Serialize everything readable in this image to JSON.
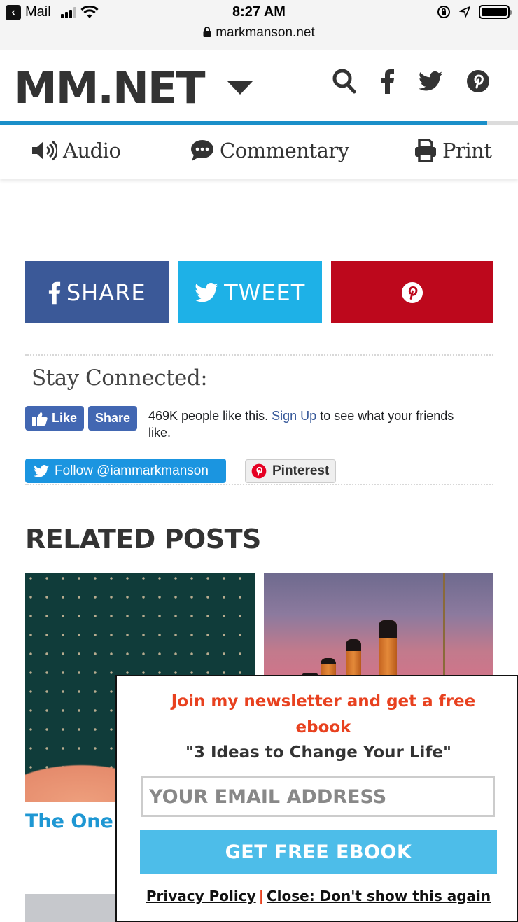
{
  "status_bar": {
    "back_app": "Mail",
    "time": "8:27 AM",
    "url": "markmanson.net",
    "icons": [
      "back-arrow-icon",
      "cellular-signal-icon",
      "wifi-icon",
      "orientation-lock-icon",
      "location-icon",
      "battery-icon"
    ]
  },
  "header": {
    "logo": "MM.NET",
    "menu_icon": "caret-down-icon",
    "icons": [
      "search-icon",
      "facebook-icon",
      "twitter-icon",
      "pinterest-icon"
    ],
    "read_progress_percent": 94,
    "colors": {
      "progress": "#1a8fc9",
      "text": "#333333"
    }
  },
  "tools": {
    "audio": "Audio",
    "commentary": "Commentary",
    "print": "Print"
  },
  "share": {
    "facebook_label": "SHARE",
    "twitter_label": "TWEET",
    "colors": {
      "facebook": "#3b5998",
      "twitter": "#1eb1e7",
      "pinterest": "#bd081c"
    }
  },
  "stay_connected": {
    "heading": "Stay Connected:",
    "fb_like": "Like",
    "fb_share": "Share",
    "fb_text_before": "469K people like this.",
    "fb_signup": "Sign Up",
    "fb_text_after": "to see what your friends like.",
    "twitter_follow": "Follow @iammarkmanson",
    "pinterest_follow": "Pinterest"
  },
  "related": {
    "heading": "RELATED POSTS",
    "posts": [
      {
        "title_visible": "The One "
      },
      {
        "title_visible": ""
      }
    ]
  },
  "popup": {
    "headline": "Join my newsletter and get a free ebook",
    "subtitle": "\"3 Ideas to Change Your Life\"",
    "email_placeholder": "YOUR EMAIL ADDRESS",
    "email_value": "",
    "button": "GET FREE EBOOK",
    "privacy": "Privacy Policy",
    "separator": "|",
    "close": "Close: Don't show this again",
    "colors": {
      "headline": "#e8411f",
      "button": "#4dbde9"
    }
  }
}
